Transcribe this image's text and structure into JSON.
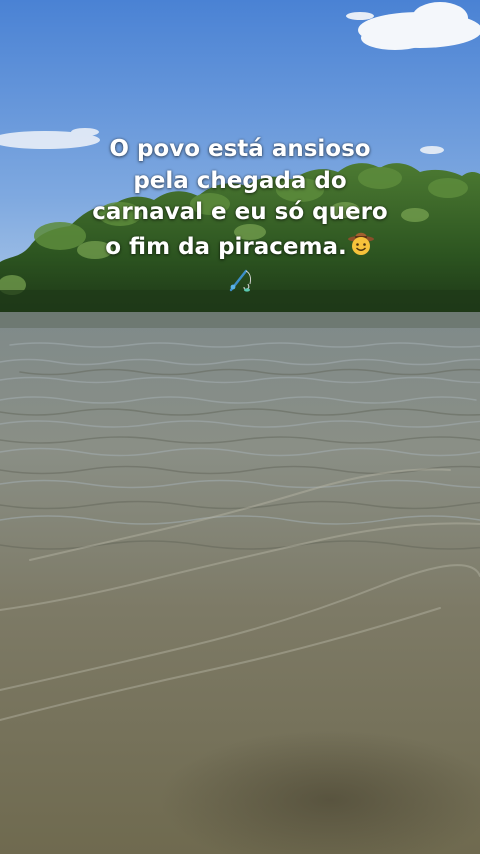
{
  "caption": {
    "line1": "O povo está ansioso",
    "line2": "pela chegada do",
    "line3": "carnaval e eu só quero",
    "line4": "o fim da piracema.",
    "emoji_1": "cowboy-face-emoji",
    "emoji_2": "fishing-pole-emoji"
  },
  "colors": {
    "sky_top": "#4f86d6",
    "sky_bottom": "#a9c8ea",
    "trees": "#2f5a22",
    "water_near": "#7c7458",
    "water_far": "#8f9aa0",
    "caption_text": "#ffffff"
  }
}
